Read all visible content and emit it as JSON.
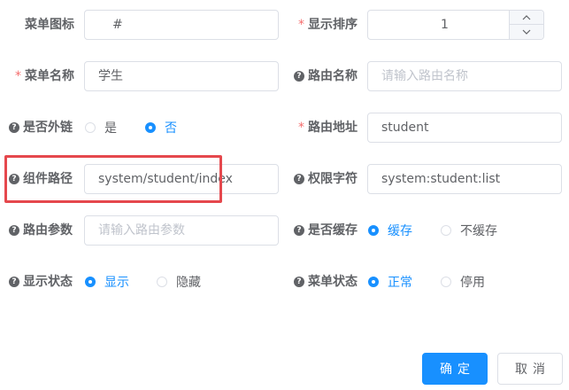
{
  "form": {
    "icon": {
      "label": "菜单图标",
      "value": "#"
    },
    "sort": {
      "label": "显示排序",
      "value": "1"
    },
    "menu_name": {
      "label": "菜单名称",
      "value": "学生"
    },
    "route_name": {
      "label": "路由名称",
      "placeholder": "请输入路由名称"
    },
    "is_frame": {
      "label": "是否外链",
      "options": [
        "是",
        "否"
      ],
      "selected": "否"
    },
    "path": {
      "label": "路由地址",
      "value": "student"
    },
    "component": {
      "label": "组件路径",
      "value": "system/student/index"
    },
    "perms": {
      "label": "权限字符",
      "value": "system:student:list"
    },
    "query": {
      "label": "路由参数",
      "placeholder": "请输入路由参数"
    },
    "is_cache": {
      "label": "是否缓存",
      "options": [
        "缓存",
        "不缓存"
      ],
      "selected": "缓存"
    },
    "visible": {
      "label": "显示状态",
      "options": [
        "显示",
        "隐藏"
      ],
      "selected": "显示"
    },
    "status": {
      "label": "菜单状态",
      "options": [
        "正常",
        "停用"
      ],
      "selected": "正常"
    }
  },
  "footer": {
    "confirm_label": "确定",
    "cancel_label": "取消"
  },
  "colors": {
    "primary": "#1890ff",
    "required": "#f56c6c",
    "highlight": "#e5484d"
  }
}
